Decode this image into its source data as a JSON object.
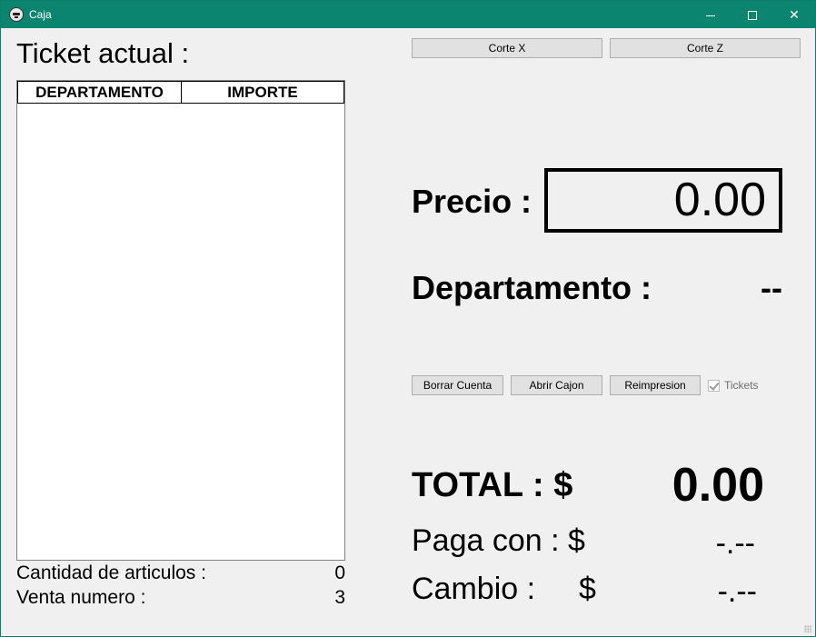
{
  "window": {
    "title": "Caja",
    "minimize_icon": "minimize-icon",
    "maximize_icon": "maximize-icon",
    "close_icon": "close-icon",
    "accent_color": "#0b8470"
  },
  "ticket": {
    "title": "Ticket actual :",
    "columns": [
      "DEPARTAMENTO",
      "IMPORTE"
    ],
    "rows": []
  },
  "stats": {
    "cantidad_label": "Cantidad de articulos :",
    "cantidad_value": "0",
    "venta_label": "Venta numero :",
    "venta_value": "3"
  },
  "toolbar": {
    "corte_x": "Corte X",
    "corte_z": "Corte Z"
  },
  "precio": {
    "label": "Precio :",
    "value": "0.00"
  },
  "departamento": {
    "label": "Departamento :",
    "value": "--"
  },
  "actions": {
    "borrar": "Borrar Cuenta",
    "abrir": "Abrir Cajon",
    "reimpresion": "Reimpresion",
    "tickets_label": "Tickets",
    "tickets_checked": true
  },
  "totals": {
    "total_label": "TOTAL : $",
    "total_value": "0.00",
    "paga_label": "Paga con : $",
    "paga_value": "-.--",
    "cambio_label": "Cambio :",
    "cambio_dollar": "$",
    "cambio_value": "-.--"
  }
}
